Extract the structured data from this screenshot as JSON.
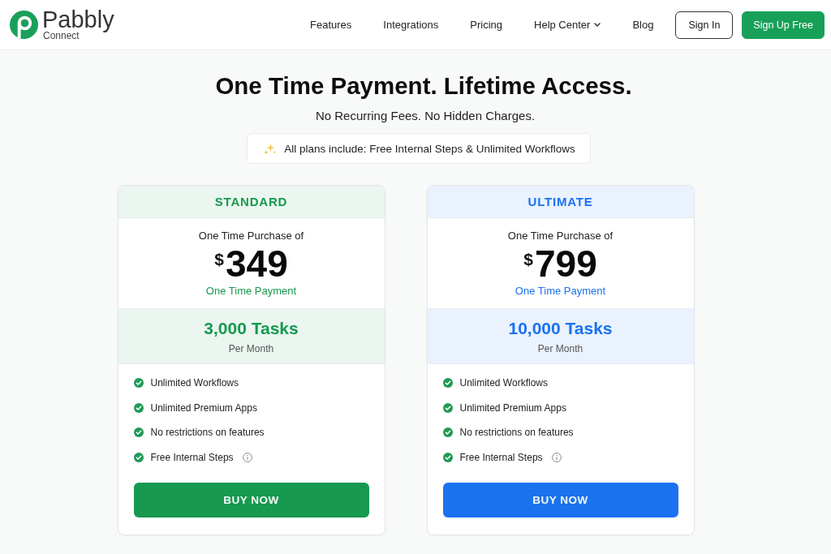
{
  "header": {
    "logo": {
      "name": "Pabbly",
      "subtitle": "Connect"
    },
    "nav": [
      {
        "label": "Features",
        "dropdown": false
      },
      {
        "label": "Integrations",
        "dropdown": false
      },
      {
        "label": "Pricing",
        "dropdown": false
      },
      {
        "label": "Help Center",
        "dropdown": true
      },
      {
        "label": "Blog",
        "dropdown": false
      }
    ],
    "buttons": [
      {
        "label": "Sign In",
        "kind": "outline"
      },
      {
        "label": "Sign Up Free",
        "kind": "primary"
      }
    ]
  },
  "hero": {
    "title": "One Time Payment. Lifetime Access.",
    "subtitle": "No Recurring Fees. No Hidden Charges.",
    "banner": "All plans include: Free Internal Steps & Unlimited Workflows"
  },
  "plans": [
    {
      "name": "STANDARD",
      "color": "#17994f",
      "purchase_label": "One Time Purchase of",
      "currency": "$",
      "price": "349",
      "payment_note": "One Time Payment",
      "tasks": "3,000 Tasks",
      "tasks_period": "Per Month",
      "features": [
        {
          "label": "Unlimited Workflows",
          "included": true,
          "info": false
        },
        {
          "label": "Unlimited Premium Apps",
          "included": true,
          "info": false
        },
        {
          "label": "No restrictions on features",
          "included": true,
          "info": false
        },
        {
          "label": "Free Internal Steps",
          "included": true,
          "info": true
        }
      ],
      "button": "BUY NOW"
    },
    {
      "name": "ULTIMATE",
      "color": "#1b72ef",
      "purchase_label": "One Time Purchase of",
      "currency": "$",
      "price": "799",
      "payment_note": "One Time Payment",
      "tasks": "10,000 Tasks",
      "tasks_period": "Per Month",
      "features": [
        {
          "label": "Unlimited Workflows",
          "included": true,
          "info": false
        },
        {
          "label": "Unlimited Premium Apps",
          "included": true,
          "info": false
        },
        {
          "label": "No restrictions on features",
          "included": true,
          "info": false
        },
        {
          "label": "Free Internal Steps",
          "included": true,
          "info": true
        }
      ],
      "button": "BUY NOW"
    }
  ]
}
